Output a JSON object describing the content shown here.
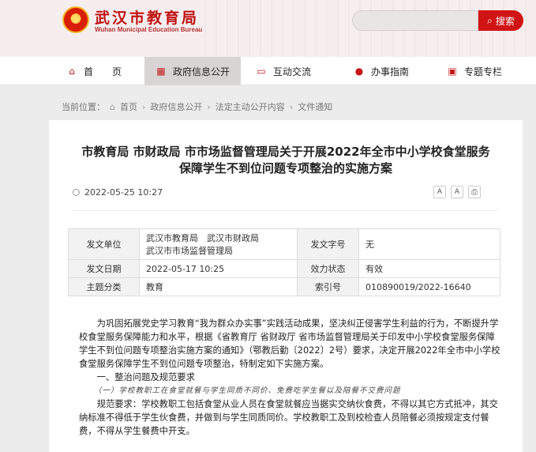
{
  "site": {
    "title": "武汉市教育局",
    "subtitle": "Wuhan Municipal Education Bureau"
  },
  "search": {
    "placeholder": "",
    "button_label": "搜索"
  },
  "nav": [
    {
      "label": "首　　页",
      "icon": "home-icon"
    },
    {
      "label": "政府信息公开",
      "icon": "calendar-icon"
    },
    {
      "label": "互动交流",
      "icon": "chat-icon"
    },
    {
      "label": "办事指南",
      "icon": "user-icon"
    },
    {
      "label": "专题专栏",
      "icon": "bookmark-icon"
    }
  ],
  "breadcrumb": {
    "prefix": "当前位置：",
    "items": [
      "首页",
      "政府信息公开",
      "法定主动公开内容",
      "文件通知"
    ]
  },
  "article": {
    "title_line1": "市教育局 市财政局 市市场监督管理局关于开展2022年全市中小学校食堂服务",
    "title_line2": "保障学生不到位问题专项整治的实施方案",
    "datetime": "2022-05-25 10:27",
    "font_large": "A",
    "font_small": "A"
  },
  "info_table": {
    "publisher_label": "发文单位",
    "publisher_line1": "武汉市教育局　武汉市财政局",
    "publisher_line2": "武汉市市场监督管理局",
    "doc_no_label": "发文字号",
    "doc_no": "无",
    "date_label": "发文日期",
    "date": "2022-05-17 10:25",
    "status_label": "效力状态",
    "status": "有效",
    "topic_label": "主题分类",
    "topic": "教育",
    "index_label": "索引号",
    "index": "010890019/2022-16640"
  },
  "body": {
    "p1": "为巩固拓展党史学习教育“我为群众办实事”实践活动成果，坚决纠正侵害学生利益的行为，不断提升学校食堂服务保障能力和水平，根据《省教育厅 省财政厅 省市场监督管理局关于印发中小学校食堂服务保障学生不到位问题专项整治实施方案的通知》（鄂教后勤〔2022〕2号）要求，决定开展2022年全市中小学校食堂服务保障学生不到位问题专项整治，特制定如下实施方案。",
    "section1": "一、整治问题及规范要求",
    "sub1": "（一）学校教职工在食堂就餐与学生同质不同价、免费吃学生餐以及陪餐不交费问题",
    "p2": "规范要求：学校教职工包括食堂从业人员在食堂就餐应当据实交纳伙食费，不得以其它方式抵冲，其交纳标准不得低于学生伙食费，并做到与学生同质同价。学校教职工及到校检查人员陪餐必须按规定支付餐费，不得从学生餐费中开支。"
  }
}
